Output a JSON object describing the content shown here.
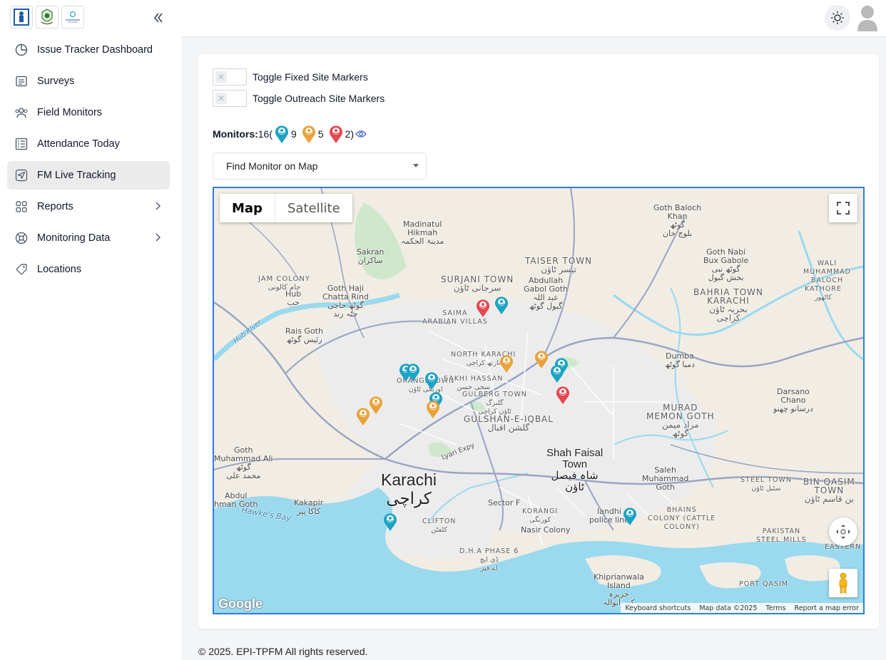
{
  "sidebar": {
    "items": [
      {
        "label": "Issue Tracker Dashboard",
        "icon": "pie-chart-icon"
      },
      {
        "label": "Surveys",
        "icon": "survey-list-icon"
      },
      {
        "label": "Field Monitors",
        "icon": "users-icon"
      },
      {
        "label": "Attendance Today",
        "icon": "checklist-icon"
      },
      {
        "label": "FM Live Tracking",
        "icon": "navigation-icon",
        "active": true
      },
      {
        "label": "Reports",
        "icon": "grid-icon",
        "expandable": true
      },
      {
        "label": "Monitoring Data",
        "icon": "support-icon",
        "expandable": true
      },
      {
        "label": "Locations",
        "icon": "tag-icon"
      }
    ]
  },
  "toggles": {
    "fixed": "Toggle Fixed Site Markers",
    "outreach": "Toggle Outreach Site Markers"
  },
  "monitors": {
    "label": "Monitors:",
    "total": "16(",
    "teal_count": "9",
    "orange_count": "5",
    "red_count": "2)",
    "colors": {
      "teal": "#1ca3c4",
      "orange": "#e9a23b",
      "red": "#e4474f"
    }
  },
  "find_monitor": {
    "value": "Find Monitor on Map"
  },
  "map": {
    "type_map": "Map",
    "type_satellite": "Satellite",
    "labels": {
      "madinatul": "Madinatul\nHikmah\nمدینۃ الحکمہ",
      "goth_baloch": "Goth Baloch\nKhan\nگوٹھ\nبلوچ خان",
      "sakran": "Sakran\nساکران",
      "jam_colony": "JAM COLONY\nجام کالونی",
      "surjani": "SURJANI TOWN\nسرجانی ٹاؤن",
      "taiser": "TAISER TOWN\nتیسر ٹاؤن",
      "abdullah": "Abdullah\nGabol Goth\nعبد اللہ\nگبول گوٹھ",
      "goth_nabi": "Goth Nabi\nBux Gabole\nگوٹھ نبی\nبخش گبول",
      "wali": "WALI\nMUHAMMAD\nBALOCH",
      "bahria": "BAHRIA TOWN\nKARACHI\nبحریہ ٹاؤن\nکراچی",
      "kathore": "KATHORE\nکاٹھور",
      "hub": "Hub\nحب",
      "goth_haji": "Goth Haji\nChatta Rind\nگوٹھ حاجی\nچٹہ رند",
      "saima": "SAIMA\nARABIAN VILLAS",
      "hub_river": "Hub River",
      "rais_goth": "Rais Goth\nرئیس گوٹھ",
      "north_karachi": "NORTH KARACHI\nنارتھ کراچی",
      "dumba": "Dumba\nدمبا گوٹھ",
      "orangi": "ORANGI TOWN\nاورنگی ٹاؤن",
      "sakhi": "SAKHI HASSAN\nسخی حسن",
      "gulberg": "GULBERG TOWN\nگلبرگ\nٹاؤن کراچی",
      "darsano": "Darsano\nChano\nدرسانو چھنو",
      "gulshan": "GULSHAN-E-IQBAL\nگلشن اقبال",
      "murad": "MURAD\nMEMON GOTH\nمراد میمن\nگوٹھ",
      "lyari": "Lyari Expy",
      "goth_muhammad": "Goth\nMuhammad Ali\nگوٹھ\nمحمد علی",
      "shah_faisal": "Shah Faisal\nTown\nشاہ فیصل\nٹاؤن",
      "karachi": "Karachi\nکراچی",
      "saleh": "Saleh\nMuhammad\nGoth",
      "steel_town": "STEEL TOWN\nسٹیل ٹاؤن",
      "bin_qasim": "BIN QASIM\nTOWN\nبن قاسم ٹاؤن",
      "abdul": "Abdul\nhman Goth",
      "kakapir": "Kakapir\nکاکا پیر",
      "hawkes": "Hawke's Bay",
      "sector_f": "Sector F",
      "korangi": "KORANGI\nکورنگی",
      "landhi": "landhi\npolice line",
      "bhains": "BHAINS\nCOLONY (CATTLE\nCOLONY)",
      "clifton": "CLIFTON\nکلفٹن",
      "nasir": "Nasir Colony",
      "pakistan_steel": "PAKISTAN\nSTEEL MILLS",
      "eastern": "EASTERN ZO",
      "dha": "D.H.A PHASE 6\nڈی ایچ\nاے فیز",
      "khiprianwala": "Khiprianwala\nIsland\nجزیرہ\nکھپرانوالہ",
      "port_qasim": "PORT QASIM"
    },
    "google": "Google",
    "attribution": [
      "Keyboard shortcuts",
      "Map data ©2025",
      "Terms",
      "Report a map error"
    ]
  },
  "footer": "© 2025. EPI-TPFM All rights reserved."
}
